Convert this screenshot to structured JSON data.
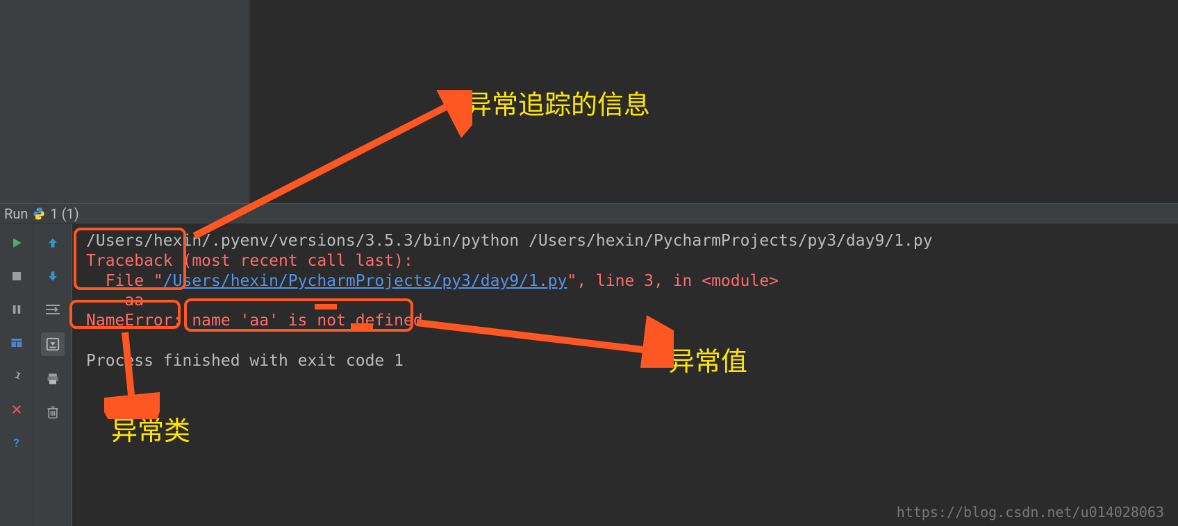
{
  "run_header": {
    "label": "Run",
    "script": "1 (1)"
  },
  "console": {
    "cmd": "/Users/hexin/.pyenv/versions/3.5.3/bin/python /Users/hexin/PycharmProjects/py3/day9/1.py",
    "traceback_label": "Traceback (most recent call last):",
    "file_prefix": "  File \"",
    "file_link": "/Users/hexin/PycharmProjects/py3/day9/1.py",
    "file_suffix": "\", line 3, in <module>",
    "code_line": "    aa",
    "error_name": "NameError",
    "error_sep": ": ",
    "error_msg": "name 'aa' is not defined",
    "blank": "",
    "exit_line": "Process finished with exit code 1"
  },
  "annotations": {
    "traceback_info": "异常追踪的信息",
    "exception_value": "异常值",
    "exception_class": "异常类"
  },
  "watermark": "https://blog.csdn.net/u014028063",
  "icons": {
    "run": "run-icon",
    "stop": "stop-icon",
    "pause": "pause-icon",
    "layout": "layout-icon",
    "pin": "pin-icon",
    "close": "close-icon",
    "help": "help-icon",
    "up": "up-arrow-icon",
    "down": "down-arrow-icon",
    "wrap": "wrap-icon",
    "scroll": "scroll-icon",
    "print": "print-icon",
    "trash": "trash-icon"
  }
}
